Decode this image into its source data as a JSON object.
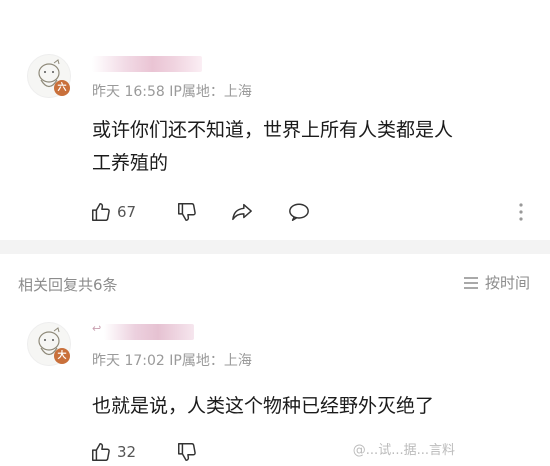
{
  "comments": [
    {
      "meta": "昨天 16:58 IP属地：上海",
      "text_line1": "或许你们还不知道，世界上所有人类都是人",
      "text_line2": "工养殖的",
      "likes": "67",
      "badge": "六"
    },
    {
      "meta": "昨天 17:02 IP属地：上海",
      "text_line1": "也就是说，人类这个物种已经野外灭绝了",
      "likes": "32",
      "badge": "大"
    }
  ],
  "replies": {
    "label": "相关回复共6条",
    "sort_label": "按时间"
  },
  "watermark": "@...试...据...言料",
  "colors": {
    "badge": "#c9703b",
    "meta": "#9a9a9a",
    "text": "#1b1b1b",
    "divider": "#f3f3f3"
  }
}
